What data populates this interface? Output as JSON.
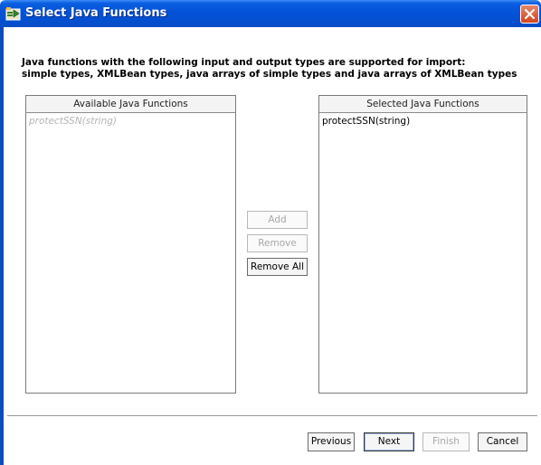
{
  "window": {
    "title": "Select Java Functions",
    "title_icon": "wizard-arrow-icon",
    "close_icon": "close-x-icon",
    "titlebar_color": "#0452d8",
    "close_color": "#d2441c"
  },
  "description": {
    "line1": "Java functions with the following input and output types are supported for import:",
    "line2": "simple types, XMLBean types, java arrays of simple types and java arrays of XMLBean types"
  },
  "available": {
    "header": "Available Java Functions",
    "items": [
      {
        "label": "protectSSN(string)",
        "disabled": true
      }
    ]
  },
  "selected": {
    "header": "Selected Java Functions",
    "items": [
      {
        "label": "protectSSN(string)",
        "disabled": false
      }
    ]
  },
  "transfer_buttons": {
    "add": "Add",
    "remove": "Remove",
    "remove_all": "Remove All"
  },
  "wizard_buttons": {
    "previous": "Previous",
    "next": "Next",
    "finish": "Finish",
    "cancel": "Cancel"
  }
}
